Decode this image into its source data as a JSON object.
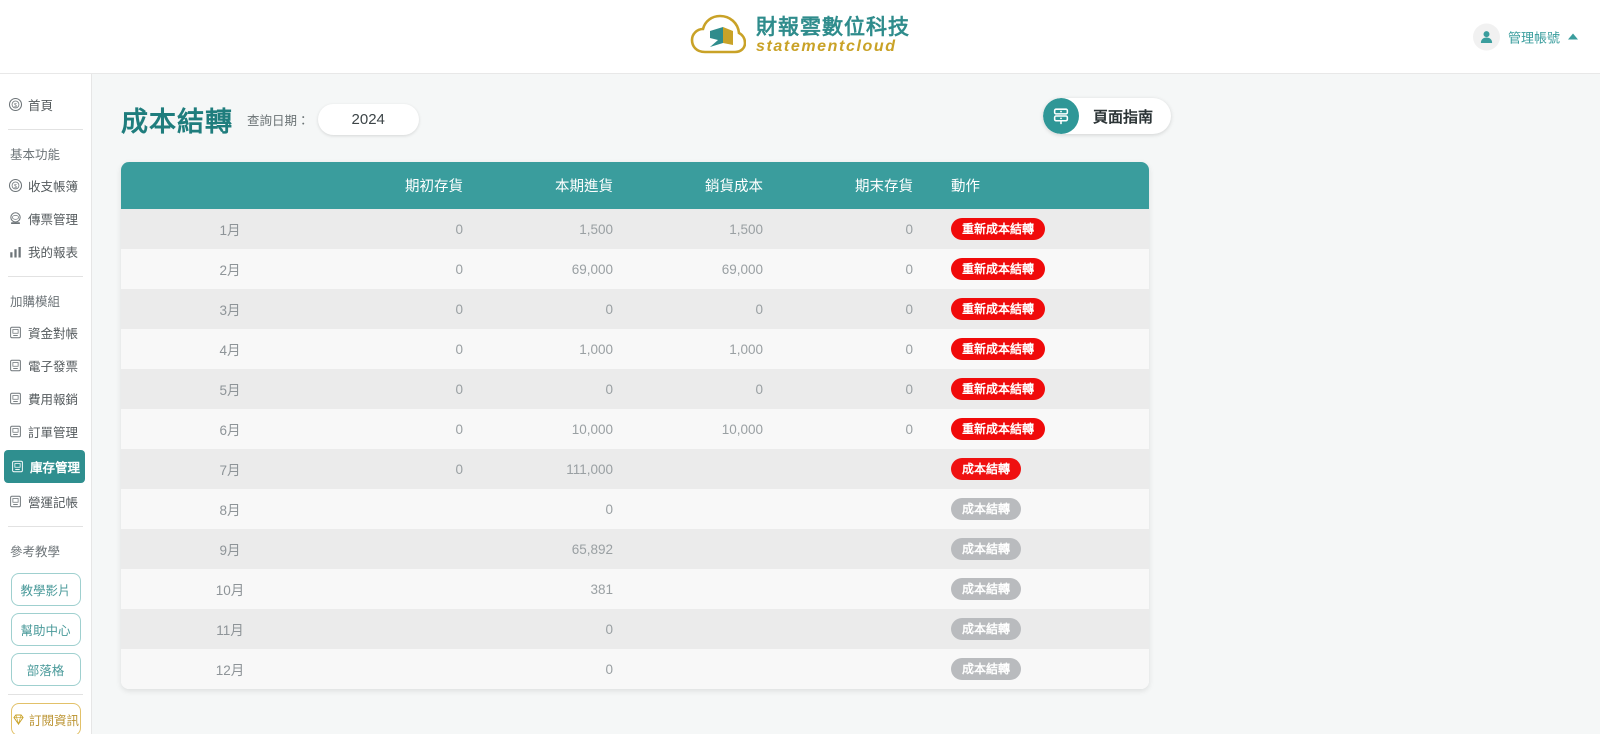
{
  "header": {
    "brand_cn": "財報雲數位科技",
    "brand_en": "statementcloud",
    "logo_icon": "cloud-logo-icon",
    "account_name": "管理帳號",
    "account_icon": "user-avatar-icon",
    "caret_icon": "caret-up-icon"
  },
  "sidebar": {
    "home": {
      "label": "首頁",
      "icon": "home-coin-icon"
    },
    "section_basic": "基本功能",
    "basic_items": [
      {
        "label": "收支帳簿",
        "icon": "coin-icon"
      },
      {
        "label": "傳票管理",
        "icon": "stamp-icon"
      },
      {
        "label": "我的報表",
        "icon": "bar-chart-icon"
      }
    ],
    "section_addon": "加購模組",
    "addon_items": [
      {
        "label": "資金對帳",
        "icon": "module-icon",
        "active": false
      },
      {
        "label": "電子發票",
        "icon": "module-icon",
        "active": false
      },
      {
        "label": "費用報銷",
        "icon": "module-icon",
        "active": false
      },
      {
        "label": "訂單管理",
        "icon": "module-icon",
        "active": false
      },
      {
        "label": "庫存管理",
        "icon": "module-icon",
        "active": true
      },
      {
        "label": "營運記帳",
        "icon": "module-icon",
        "active": false
      }
    ],
    "section_learn": "參考教學",
    "learn_buttons": [
      {
        "label": "教學影片"
      },
      {
        "label": "幫助中心"
      },
      {
        "label": "部落格"
      }
    ],
    "subscribe_button": {
      "label": "訂閱資訊",
      "icon": "gem-icon"
    }
  },
  "main": {
    "page_title": "成本結轉",
    "date_label": "查詢日期：",
    "date_value": "2024",
    "guide_button": {
      "label": "頁面指南",
      "icon": "guide-signpost-icon"
    },
    "table": {
      "columns": [
        "",
        "期初存貨",
        "本期進貨",
        "銷貨成本",
        "期末存貨",
        "動作"
      ],
      "rows": [
        {
          "month": "1月",
          "opening": "0",
          "purchase": "1,500",
          "cogs": "1,500",
          "closing": "0",
          "action": "重新成本結轉",
          "state": "redo"
        },
        {
          "month": "2月",
          "opening": "0",
          "purchase": "69,000",
          "cogs": "69,000",
          "closing": "0",
          "action": "重新成本結轉",
          "state": "redo"
        },
        {
          "month": "3月",
          "opening": "0",
          "purchase": "0",
          "cogs": "0",
          "closing": "0",
          "action": "重新成本結轉",
          "state": "redo"
        },
        {
          "month": "4月",
          "opening": "0",
          "purchase": "1,000",
          "cogs": "1,000",
          "closing": "0",
          "action": "重新成本結轉",
          "state": "redo"
        },
        {
          "month": "5月",
          "opening": "0",
          "purchase": "0",
          "cogs": "0",
          "closing": "0",
          "action": "重新成本結轉",
          "state": "redo"
        },
        {
          "month": "6月",
          "opening": "0",
          "purchase": "10,000",
          "cogs": "10,000",
          "closing": "0",
          "action": "重新成本結轉",
          "state": "redo"
        },
        {
          "month": "7月",
          "opening": "0",
          "purchase": "111,000",
          "cogs": "",
          "closing": "",
          "action": "成本結轉",
          "state": "go"
        },
        {
          "month": "8月",
          "opening": "",
          "purchase": "0",
          "cogs": "",
          "closing": "",
          "action": "成本結轉",
          "state": "off"
        },
        {
          "month": "9月",
          "opening": "",
          "purchase": "65,892",
          "cogs": "",
          "closing": "",
          "action": "成本結轉",
          "state": "off"
        },
        {
          "month": "10月",
          "opening": "",
          "purchase": "381",
          "cogs": "",
          "closing": "",
          "action": "成本結轉",
          "state": "off"
        },
        {
          "month": "11月",
          "opening": "",
          "purchase": "0",
          "cogs": "",
          "closing": "",
          "action": "成本結轉",
          "state": "off"
        },
        {
          "month": "12月",
          "opening": "",
          "purchase": "0",
          "cogs": "",
          "closing": "",
          "action": "成本結轉",
          "state": "off"
        }
      ]
    }
  },
  "colors": {
    "teal": "#3a9d9d",
    "teal_dark": "#1f7d7d",
    "gold": "#c9a227",
    "red": "#f00a0a",
    "gray_disabled": "#b9bbbe",
    "page_bg": "#f5f7f7"
  }
}
